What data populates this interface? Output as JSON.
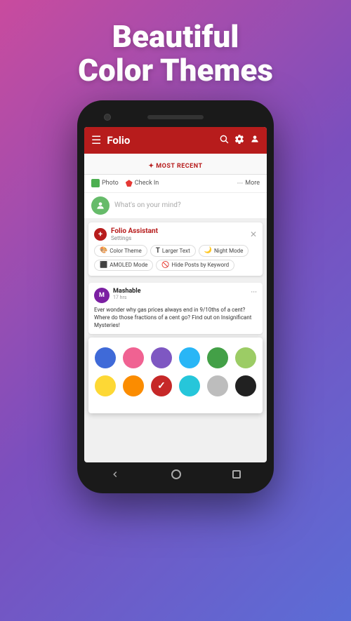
{
  "hero": {
    "title_line1": "Beautiful",
    "title_line2": "Color Themes"
  },
  "app_bar": {
    "title": "Folio",
    "menu_icon": "☰",
    "search_icon": "🔍",
    "settings_icon": "⚙",
    "account_icon": "👤"
  },
  "most_recent": {
    "label": "✦ Most Recent"
  },
  "post_actions": {
    "photo_label": "Photo",
    "checkin_label": "Check In",
    "more_label": "More"
  },
  "status": {
    "placeholder": "What's on your mind?"
  },
  "assistant": {
    "name": "Folio Assistant",
    "sub": "Settings",
    "chips": [
      {
        "icon": "🎨",
        "label": "Color Theme"
      },
      {
        "icon": "T",
        "label": "Larger Text"
      },
      {
        "icon": "🌙",
        "label": "Night Mode"
      },
      {
        "icon": "⬛",
        "label": "AMOLED Mode"
      },
      {
        "icon": "🚫",
        "label": "Hide Posts by Keyword"
      }
    ]
  },
  "feed": {
    "source": "Mashable",
    "time": "17 hrs",
    "text": "Ever wonder why gas prices always end in 9/10ths of a cent? Where do those fractions of a cent go? Find out on Insignificant Mysteries!"
  },
  "color_picker": {
    "colors_row1": [
      {
        "hex": "#3f6ad8",
        "selected": false
      },
      {
        "hex": "#f06292",
        "selected": false
      },
      {
        "hex": "#7e57c2",
        "selected": false
      },
      {
        "hex": "#29b6f6",
        "selected": false
      },
      {
        "hex": "#43a047",
        "selected": false
      },
      {
        "hex": "#9ccc65",
        "selected": false
      }
    ],
    "colors_row2": [
      {
        "hex": "#fdd835",
        "selected": false
      },
      {
        "hex": "#fb8c00",
        "selected": false
      },
      {
        "hex": "#c62828",
        "selected": true
      },
      {
        "hex": "#26c6da",
        "selected": false
      },
      {
        "hex": "#bdbdbd",
        "selected": false
      },
      {
        "hex": "#212121",
        "selected": false
      }
    ]
  },
  "nav": {
    "back": "◁",
    "home": "○",
    "square": "□"
  }
}
